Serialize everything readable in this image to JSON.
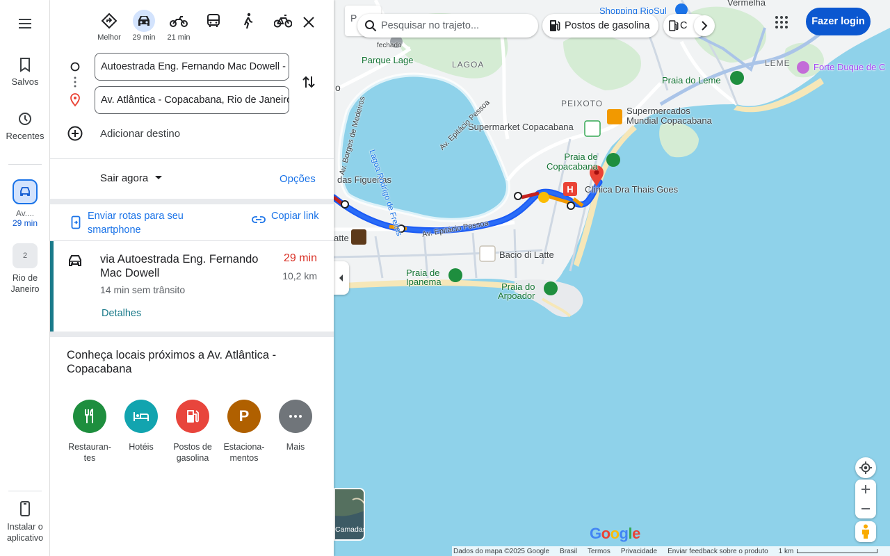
{
  "rail": {
    "saved": "Salvos",
    "recents": "Recentes",
    "trip_title": "Av....",
    "trip_time": "29 min",
    "rio_label": "Rio de Janeiro",
    "rio_count": "2",
    "install": "Instalar o aplicativo"
  },
  "modes": [
    {
      "label": "Melhor",
      "icon": "diamond-directions-icon"
    },
    {
      "label": "29 min",
      "icon": "car-icon"
    },
    {
      "label": "21 min",
      "icon": "motorcycle-icon"
    },
    {
      "label": "",
      "icon": "bus-icon"
    },
    {
      "label": "",
      "icon": "walk-icon"
    },
    {
      "label": "",
      "icon": "bicycle-icon"
    }
  ],
  "origin": "Autoestrada Eng. Fernando Mac Dowell - ",
  "destination": "Av. Atlântica - Copacabana, Rio de Janeiro",
  "add_destination": "Adicionar destino",
  "depart": "Sair agora",
  "options": "Opções",
  "send_to_phone": "Enviar rotas para seu smartphone",
  "copy_link": "Copiar link",
  "route": {
    "name": "via Autoestrada Eng. Fernando Mac Dowell",
    "sub": "14 min sem trânsito",
    "time": "29 min",
    "distance": "10,2 km",
    "details": "Detalhes",
    "time_color": "#d93025"
  },
  "nearby": {
    "title": "Conheça locais próximos a Av. Atlântica - Copacabana",
    "categories": [
      {
        "label": "Restauran-tes",
        "color": "#1e8e3e",
        "icon": "restaurant-icon"
      },
      {
        "label": "Hotéis",
        "color": "#12a4af",
        "icon": "hotel-icon"
      },
      {
        "label": "Postos de gasolina",
        "color": "#e8453c",
        "icon": "gas-station-icon"
      },
      {
        "label": "Estaciona-mentos",
        "color": "#b06000",
        "glyph": "P",
        "icon": "parking-icon"
      },
      {
        "label": "Mais",
        "color": "#70757a",
        "icon": "more-icon"
      }
    ]
  },
  "map": {
    "search_placeholder": "Pesquisar no trajeto...",
    "chip_gas": "Postos de gasolina",
    "chip_partial": "C",
    "login": "Fazer login",
    "layers": "Camadas",
    "google": "Google",
    "labels": {
      "shopping": "Shopping RioSul",
      "vermelha": "Vermelha",
      "lagoa": "LAGOA",
      "leme": "LEME",
      "forte": "Forte Duque de C",
      "parque_lage": "Parque Lage",
      "fechado": "fechado",
      "praia_leme": "Praia do Leme",
      "peixoto": "PEIXOTO",
      "supermercados": "Supermercados",
      "mundial": "Mundial Copacabana",
      "supermarket": "Supermarket Copacabana",
      "praia_copa_1": "Praia de",
      "praia_copa_2": "Copacabana",
      "clinica": "Clínica Dra Thais Goes",
      "figueiras": "das Figueiras",
      "latte": "atte",
      "bacio": "Bacio di Latte",
      "praia_ipa_1": "Praia de",
      "praia_ipa_2": "Ipanema",
      "praia_arp_1": "Praia do",
      "praia_arp_2": "Arpoador",
      "lagoa_rodrigo": "Lagoa Rodrigo de Freitas",
      "av_borges": "Av. Borges de Medeiros",
      "av_epitacio": "Av. Epitácio Pessoa",
      "av_epitacio2": "Av. Epitácio Pessoa",
      "o_letter": "o",
      "p_letter": "P"
    },
    "footer": {
      "data": "Dados do mapa ©2025 Google",
      "country": "Brasil",
      "terms": "Termos",
      "privacy": "Privacidade",
      "feedback": "Enviar feedback sobre o produto",
      "scale": "1 km"
    },
    "colors": {
      "water": "#8fd2ea",
      "land": "#f1f3f4",
      "route": "#1a5af5",
      "traffic": "#f29900",
      "congestion": "#c5221f"
    }
  }
}
